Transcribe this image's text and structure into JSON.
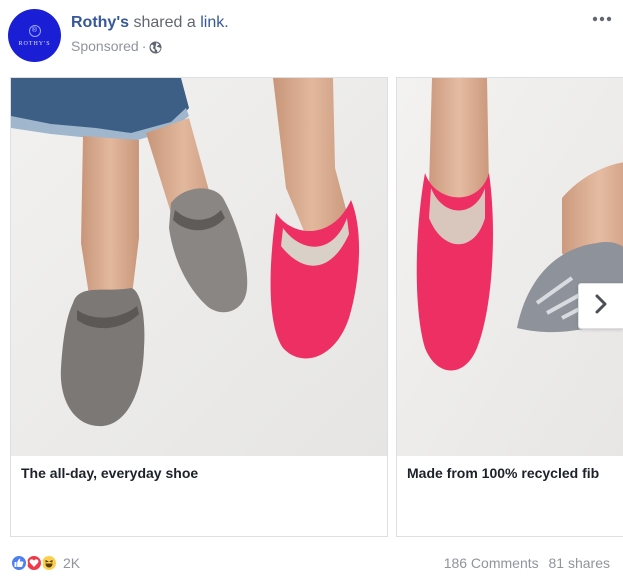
{
  "post": {
    "page_name": "Rothy's",
    "shared_text": "shared a",
    "link_word": "link.",
    "sponsored": "Sponsored",
    "sponsored_separator": "·",
    "avatar_text": "ROTHY'S",
    "more_icon": "more-options-icon"
  },
  "carousel": {
    "cards": [
      {
        "caption": "The all-day, everyday shoe",
        "image": "grey-loafers-and-pink-flats"
      },
      {
        "caption": "Made from 100% recycled fib",
        "image": "pink-flat-and-zebra-flat"
      }
    ],
    "next_icon": "chevron-right-icon"
  },
  "footer": {
    "reactions": [
      "like-icon",
      "love-icon",
      "haha-icon"
    ],
    "reaction_count": "2K",
    "comments": "186 Comments",
    "shares": "81 shares"
  },
  "colors": {
    "link_blue": "#365899",
    "muted_text": "#90949c",
    "avatar_blue": "#1a1fd6",
    "pink_shoe": "#ee2f63",
    "grey_shoe": "#7c7876"
  }
}
